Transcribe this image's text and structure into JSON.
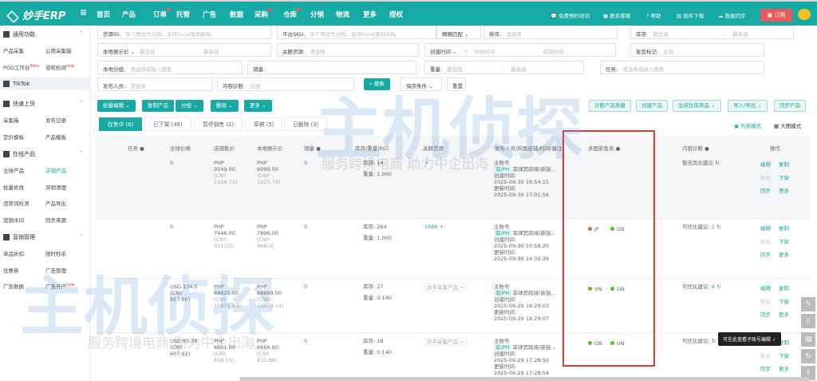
{
  "header": {
    "logo": "妙手ERP",
    "menu_icon": "menu-icon",
    "nav": [
      "首页",
      "产品",
      "订单",
      "托管",
      "广告",
      "数据",
      "采购",
      "仓库",
      "分销",
      "物流",
      "更多",
      "授权"
    ],
    "links": [
      "免费预约培训",
      "联系客服",
      "帮助",
      "插件下载",
      "数据同步"
    ],
    "order": "订购"
  },
  "sidebar": {
    "groups": [
      {
        "title": "通用功能",
        "items": [
          "产品采集",
          "公用采集箱",
          "POD工作台",
          "侵权检测"
        ],
        "badges": {
          "POD工作台": "Beta",
          "侵权检测": "new"
        }
      },
      {
        "title": "TikTok",
        "items": []
      },
      {
        "title": "快速上货",
        "items": [
          "采集箱",
          "发布记录",
          "定价模板",
          "产品模板"
        ]
      },
      {
        "title": "在线产品",
        "items": [
          "全球产品",
          "店铺产品",
          "批量修改",
          "滞销清理",
          "违禁词检测",
          "产品导出",
          "营销水印",
          "同步来源"
        ]
      },
      {
        "title": "营销管理",
        "items": [
          "单品折扣",
          "限时秒杀",
          "优惠券",
          "广告管理",
          "广告数据",
          "广告开户"
        ],
        "badges": {
          "广告开户": "new"
        }
      }
    ]
  },
  "filters": {
    "source_id": {
      "label": "货源ID:",
      "placeholder": "多个用逗号分隔，支持Excel复制粘贴"
    },
    "platform_sku": {
      "label": "平台SKU:",
      "placeholder": "多个用逗号分隔，支持Excel复制粘贴"
    },
    "match": "精确匹配",
    "sort": {
      "label": "排序:",
      "placeholder": "请选择"
    },
    "stock": {
      "label": "库存:",
      "min": "最低值",
      "max": "最高值"
    },
    "local_price": {
      "label": "本地展示价",
      "min": "最低值",
      "max": "最高值"
    },
    "linked_source": {
      "label": "关联货源:",
      "placeholder": "请选择"
    },
    "created": {
      "label": "创建时间",
      "start": "开始时间",
      "end": "结束时间"
    },
    "starred": {
      "label": "星舌标记:",
      "value": "全部"
    },
    "local_group": {
      "label": "本地分组:",
      "placeholder": "请选择或输入搜索"
    },
    "sales": {
      "label": "销量:"
    },
    "weight": {
      "label": "重量:",
      "min": "最低值",
      "max": "最高值"
    },
    "task": {
      "label": "任务:",
      "placeholder": "请选择或输入搜索"
    },
    "publisher": {
      "label": "发布人员:",
      "placeholder": "请选择"
    },
    "content_diag": {
      "label": "内容诊断:",
      "value": "全部"
    },
    "search": "搜索",
    "save_cond": "保存条件",
    "reset": "重置"
  },
  "toolbar": {
    "left": [
      "批量编辑",
      "复制产品",
      "分组",
      "删除",
      "更多"
    ],
    "right": [
      "诊断产品质量",
      "创建产品",
      "生成仓库商品",
      "导入/导出",
      "同步产品"
    ],
    "view_list": "列表模式",
    "view_grid": "大图模式"
  },
  "tabs": [
    "在售中 (6)",
    "已下架 (48)",
    "暂停销售 (2)",
    "草稿 (5)",
    "已删除 (3)"
  ],
  "table": {
    "headers": [
      "任务",
      "全球价格",
      "店铺售价",
      "本地展示价",
      "销量",
      "库存/重量(KG)",
      "关联货源",
      "发布人员/所属店铺/时间/备注",
      "多国家售卖",
      "内容诊断",
      "操作"
    ],
    "rows": [
      {
        "global": "0",
        "shop": [
          "PHP",
          "9549.00",
          "(CNY",
          "1168.72)"
        ],
        "local": [
          "PHP",
          "9999.00",
          "(CNY",
          "1223.79)"
        ],
        "sales": "0",
        "stock": "库存: 14",
        "weight": "重量: 1.000",
        "source": "+",
        "account": "主账号",
        "store_tag": "菲/PH",
        "store": "菲律宾跨境(新链...",
        "created_label": "创建时间:",
        "created": "2025-09-30 16:54:15",
        "updated_label": "更新时间:",
        "updated": "2025-09-30 17:01:56",
        "countries": [],
        "diag": "暂无优化建议",
        "diag_count": ""
      },
      {
        "global": "0",
        "shop": [
          "PHP",
          "7446.00",
          "(CNY",
          "911.33)"
        ],
        "local": [
          "PHP",
          "7896.00",
          "(CNY",
          "966.4)"
        ],
        "sales": "0",
        "stock": "库存: 264",
        "weight": "重量: 1.000",
        "source": "1688 +",
        "account": "主账号",
        "store_tag": "菲/PH",
        "store": "菲律宾跨境(新链...",
        "created_label": "创建时间:",
        "created": "2025-09-30 10:58:20",
        "updated_label": "更新时间:",
        "updated": "2025-09-30 14:33:39",
        "countries": [
          {
            "code": "JP",
            "color": "#e25b5b"
          },
          {
            "code": "GB",
            "color": "#52c41a"
          }
        ],
        "diag": "可优化建议:",
        "diag_count": "1"
      },
      {
        "global": "USD 134.5 (CNY 957.66)",
        "shop": [
          "PHP",
          "88825.00",
          "(CNY",
          "10871.43)"
        ],
        "local": [
          "PHP",
          "88888.00",
          "(CNY",
          "10879.14)"
        ],
        "sales": "0",
        "stock": "库存: 27",
        "weight": "重量: 0.140",
        "source": "妙手采集产品 +",
        "account": "主账号",
        "store_tag": "菲/PH",
        "store": "菲律宾跨境(新链...",
        "created_label": "创建时间:",
        "created": "2025-09-29 18:29:03",
        "updated_label": "更新时间:",
        "updated": "2025-09-29 18:29:07",
        "countries": [
          {
            "code": "VN",
            "color": "#52c41a"
          },
          {
            "code": "GB",
            "color": "#52c41a"
          }
        ],
        "diag": "可优化建议:",
        "diag_count": "4"
      },
      {
        "global": "USD 85.38 (CNY 607.92)",
        "shop": [
          "PHP",
          "6601.00",
          "(CNY",
          "808.15)"
        ],
        "local": [
          "PHP",
          "6666.00",
          "(CNY",
          "815.86)"
        ],
        "sales": "0",
        "stock": "库存: 18",
        "weight": "重量: 0.140",
        "source": "妙手采集产品 +",
        "account": "主账号",
        "store_tag": "菲/PH",
        "store": "菲律宾跨境(新链...",
        "created_label": "创建时间:",
        "created": "2025-09-29 17:28:50",
        "updated_label": "更新时间:",
        "updated": "2025-09-29 17:28:54",
        "countries": [
          {
            "code": "GB",
            "color": "#52c41a"
          },
          {
            "code": "VN",
            "color": "#52c41a"
          }
        ],
        "diag": "可优化建议:",
        "diag_count": ""
      }
    ],
    "actions": [
      "编辑",
      "复制",
      "删除",
      "下架",
      "同步",
      "更多"
    ]
  },
  "tooltip": "可在此查看子账号编辑 ✓",
  "watermark": {
    "brand": "主机侦探",
    "slogan": "服务跨境电商 助力中企出海"
  },
  "colors": {
    "primary": "#17aaa4",
    "highlight_box": "#e53935",
    "order": "#e9585c"
  }
}
